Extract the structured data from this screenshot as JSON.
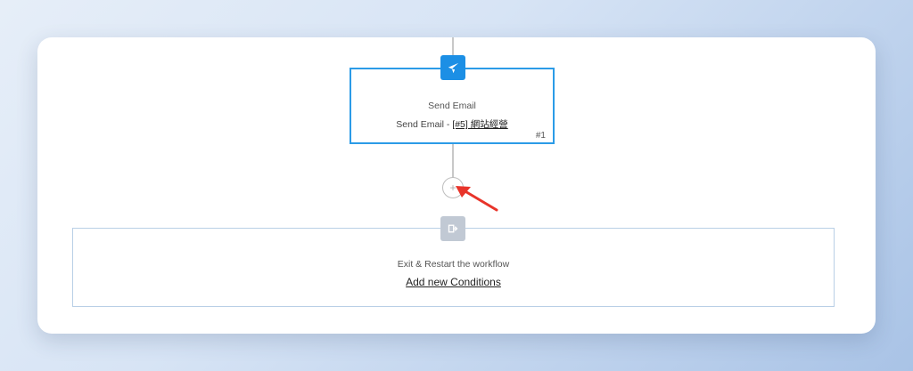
{
  "workflow": {
    "email_node": {
      "title": "Send Email",
      "subtitle_prefix": "Send Email - ",
      "subtitle_link": "[#5] 網站經營",
      "number": "#1",
      "icon": "paper-plane-icon"
    },
    "add_button": {
      "symbol": "+",
      "icon": "plus-icon"
    },
    "exit_node": {
      "title": "Exit & Restart the workflow",
      "link": "Add new Conditions",
      "icon": "exit-door-icon"
    }
  },
  "annotation": {
    "icon": "red-arrow-icon",
    "color": "#e8342a"
  },
  "colors": {
    "accent": "#1c8fe5",
    "email_border": "#2b9be7",
    "exit_border": "#b9cfe6",
    "exit_icon_bg": "#c1c9d4"
  }
}
